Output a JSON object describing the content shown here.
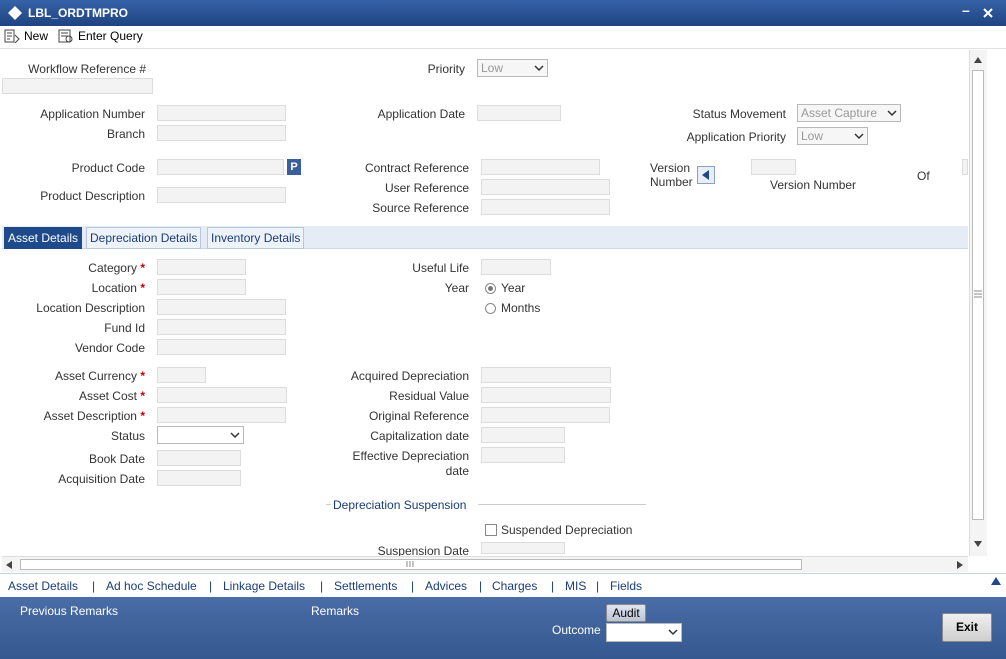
{
  "window": {
    "title": "LBL_ORDTMPRO"
  },
  "toolbar": {
    "new_label": "New",
    "enter_query_label": "Enter Query"
  },
  "header": {
    "workflow_ref_label": "Workflow Reference #",
    "priority_label": "Priority",
    "priority_value": "Low",
    "application_number_label": "Application Number",
    "branch_label": "Branch",
    "application_date_label": "Application Date",
    "status_movement_label": "Status Movement",
    "status_movement_value": "Asset Capture",
    "application_priority_label": "Application Priority",
    "application_priority_value": "Low",
    "product_code_label": "Product Code",
    "product_code_button": "P",
    "product_description_label": "Product Description",
    "contract_reference_label": "Contract Reference",
    "user_reference_label": "User Reference",
    "source_reference_label": "Source Reference",
    "version_number_label": "Version Number",
    "version_number_label_2": "Version Number",
    "of_label": "Of"
  },
  "tabs": [
    "Asset Details",
    "Depreciation Details",
    "Inventory Details"
  ],
  "asset": {
    "category_label": "Category",
    "location_label": "Location",
    "location_description_label": "Location Description",
    "fund_id_label": "Fund Id",
    "vendor_code_label": "Vendor Code",
    "useful_life_label": "Useful Life",
    "year_label": "Year",
    "radio_year": "Year",
    "radio_months": "Months",
    "asset_currency_label": "Asset Currency",
    "asset_cost_label": "Asset Cost",
    "asset_description_label": "Asset Description",
    "status_label": "Status",
    "book_date_label": "Book Date",
    "acquisition_date_label": "Acquisition Date",
    "acquired_depreciation_label": "Acquired Depreciation",
    "residual_value_label": "Residual Value",
    "original_reference_label": "Original Reference",
    "capitalization_date_label": "Capitalization date",
    "effective_depreciation_label_1": "Effective Depreciation",
    "effective_depreciation_label_2": "date",
    "depreciation_suspension_label": "Depreciation Suspension",
    "suspended_depreciation_label": "Suspended Depreciation",
    "suspension_date_label": "Suspension Date",
    "required_mark": "*"
  },
  "bottom_links": [
    "Asset Details",
    "Ad hoc Schedule",
    "Linkage Details",
    "Settlements",
    "Advices",
    "Charges",
    "MIS",
    "Fields"
  ],
  "bottom_sep": "|",
  "footer": {
    "previous_remarks_label": "Previous Remarks",
    "remarks_label": "Remarks",
    "audit_label": "Audit",
    "outcome_label": "Outcome",
    "exit_label": "Exit"
  },
  "colors": {
    "titlebar": "#2b4f8f",
    "footer": "#3b5f9b",
    "tab_active": "#1e4a8c",
    "link": "#1a3c78"
  }
}
